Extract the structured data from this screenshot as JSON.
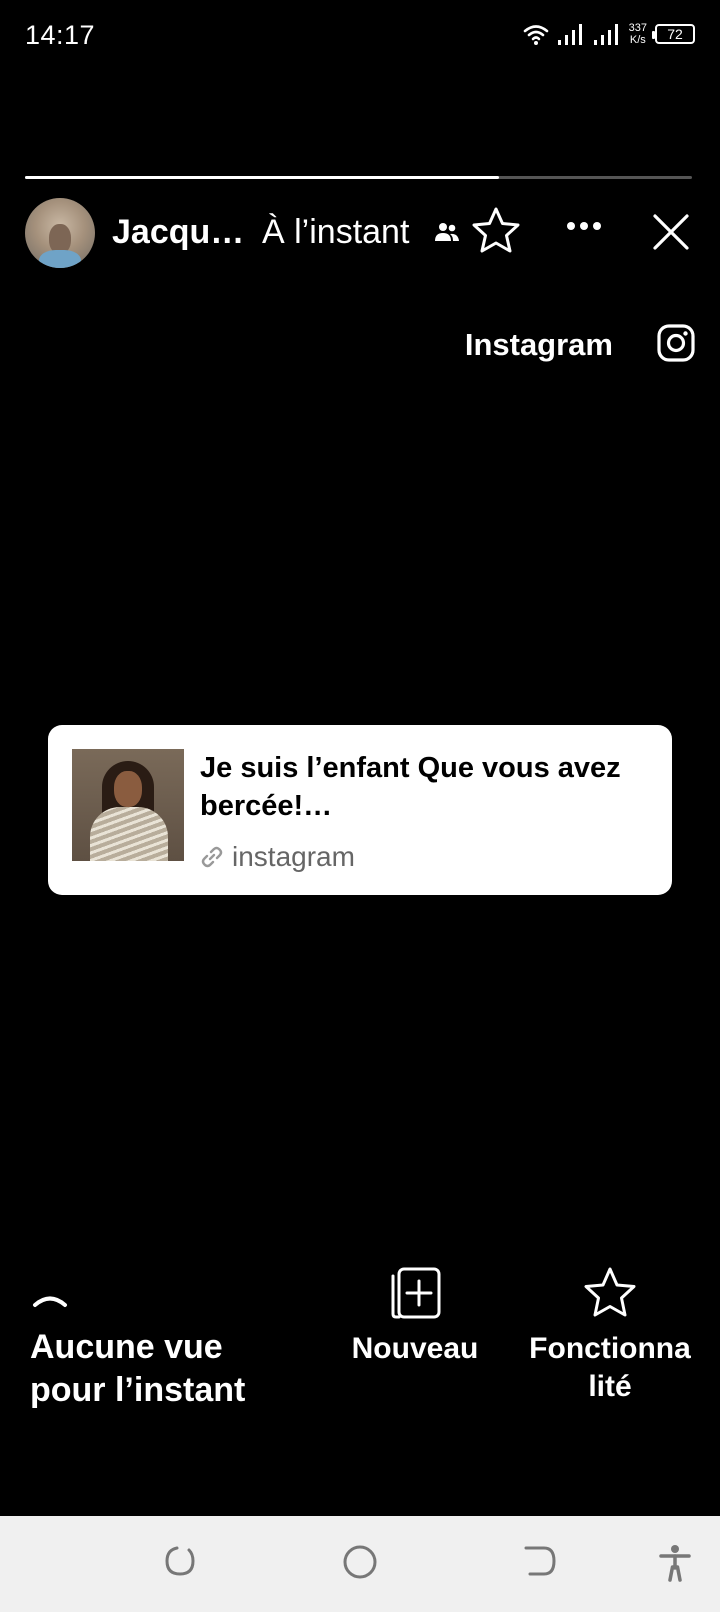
{
  "status_bar": {
    "time": "14:17",
    "net_speed_value": "337",
    "net_speed_unit": "K/s",
    "battery": "72",
    "icons": [
      "wifi-icon",
      "signal-icon",
      "signal-icon",
      "battery-icon"
    ]
  },
  "story": {
    "progress": 0.71,
    "author_name": "Jacque…",
    "time_ago": "À l’instant",
    "audience_icon": "friends-icon",
    "source_label": "Instagram",
    "source_icon": "instagram-icon"
  },
  "link_card": {
    "title": "Je suis l’enfant Que vous avez bercée!…",
    "source": "instagram",
    "source_icon": "link-icon"
  },
  "bottom": {
    "views_label": "Aucune vue pour l’instant",
    "new_label": "Nouveau",
    "feature_label": "Fonctionna lité"
  },
  "colors": {
    "background": "#000000",
    "text": "#ffffff",
    "card_background": "#ffffff",
    "navbar_background": "#f0f0f0"
  }
}
